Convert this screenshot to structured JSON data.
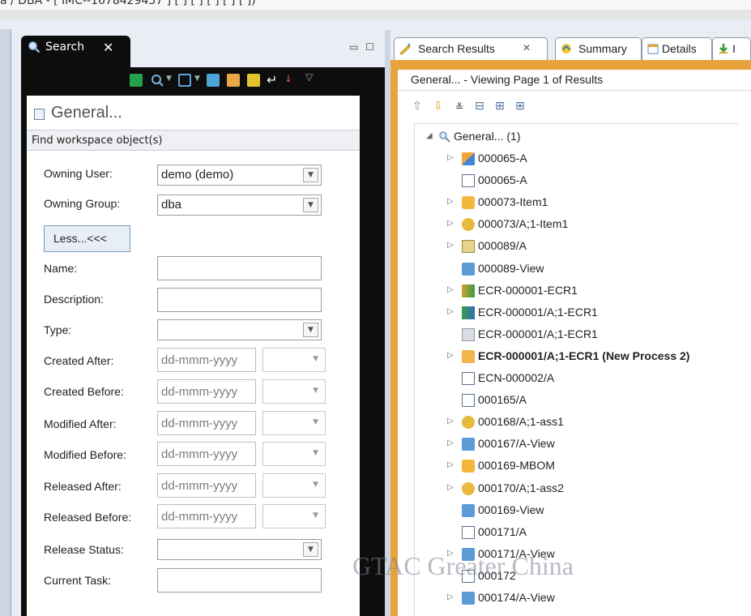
{
  "window": {
    "title_fragment": "a / DBA - [ IMC--1678429437 ] [ ] [ ] [ ] [ ] [ ])"
  },
  "search_view": {
    "tab_label": "Search",
    "form_title": "General...",
    "section_header": "Find workspace object(s)",
    "fields": {
      "owning_user": {
        "label": "Owning User:",
        "value": "demo (demo)"
      },
      "owning_group": {
        "label": "Owning Group:",
        "value": "dba"
      },
      "less_button": "Less...<<<",
      "name": {
        "label": "Name:",
        "value": ""
      },
      "description": {
        "label": "Description:",
        "value": ""
      },
      "type": {
        "label": "Type:",
        "value": ""
      },
      "created_after": {
        "label": "Created After:",
        "placeholder": "dd-mmm-yyyy"
      },
      "created_before": {
        "label": "Created Before:",
        "placeholder": "dd-mmm-yyyy"
      },
      "modified_after": {
        "label": "Modified After:",
        "placeholder": "dd-mmm-yyyy"
      },
      "modified_before": {
        "label": "Modified Before:",
        "placeholder": "dd-mmm-yyyy"
      },
      "released_after": {
        "label": "Released After:",
        "placeholder": "dd-mmm-yyyy"
      },
      "released_before": {
        "label": "Released Before:",
        "placeholder": "dd-mmm-yyyy"
      },
      "release_status": {
        "label": "Release Status:",
        "value": ""
      },
      "current_task": {
        "label": "Current Task:",
        "value": ""
      }
    }
  },
  "results_view": {
    "tabs": [
      {
        "label": "Search Results",
        "icon": "search-results-icon",
        "active": true
      },
      {
        "label": "Summary",
        "icon": "summary-icon"
      },
      {
        "label": "Details",
        "icon": "details-icon"
      },
      {
        "label": "I",
        "icon": "impact-icon"
      }
    ],
    "status": "General... - Viewing Page 1 of Results",
    "root": {
      "label": "General... (1)",
      "icon": "search-icon"
    },
    "items": [
      {
        "label": "000065-A",
        "icon": "item-revision-icon",
        "expandable": true,
        "bold": false
      },
      {
        "label": "000065-A",
        "icon": "dataset-icon",
        "expandable": false,
        "bold": false
      },
      {
        "label": "000073-Item1",
        "icon": "item-icon",
        "expandable": true,
        "bold": false
      },
      {
        "label": "000073/A;1-Item1",
        "icon": "assembly-icon",
        "expandable": true,
        "bold": false
      },
      {
        "label": "000089/A",
        "icon": "folder-icon",
        "expandable": true,
        "bold": false
      },
      {
        "label": "000089-View",
        "icon": "bom-view-icon",
        "expandable": false,
        "bold": false
      },
      {
        "label": "ECR-000001-ECR1",
        "icon": "change-icon",
        "expandable": true,
        "bold": false
      },
      {
        "label": "ECR-000001/A;1-ECR1",
        "icon": "change-revision-icon",
        "expandable": true,
        "bold": false
      },
      {
        "label": "ECR-000001/A;1-ECR1",
        "icon": "form-icon",
        "expandable": false,
        "bold": false
      },
      {
        "label": "ECR-000001/A;1-ECR1 (New Process 2)",
        "icon": "process-icon",
        "expandable": true,
        "bold": true
      },
      {
        "label": "ECN-000002/A",
        "icon": "dataset-icon",
        "expandable": false,
        "bold": false
      },
      {
        "label": "000165/A",
        "icon": "dataset-icon",
        "expandable": false,
        "bold": false
      },
      {
        "label": "000168/A;1-ass1",
        "icon": "assembly-icon",
        "expandable": true,
        "bold": false
      },
      {
        "label": "000167/A-View",
        "icon": "bom-view-icon",
        "expandable": true,
        "bold": false
      },
      {
        "label": "000169-MBOM",
        "icon": "item-icon",
        "expandable": true,
        "bold": false
      },
      {
        "label": "000170/A;1-ass2",
        "icon": "assembly-icon",
        "expandable": true,
        "bold": false
      },
      {
        "label": "000169-View",
        "icon": "bom-view-icon",
        "expandable": false,
        "bold": false
      },
      {
        "label": "000171/A",
        "icon": "dataset-icon",
        "expandable": false,
        "bold": false
      },
      {
        "label": "000171/A-View",
        "icon": "bom-view-icon",
        "expandable": true,
        "bold": false
      },
      {
        "label": "000172",
        "icon": "dataset-icon",
        "expandable": false,
        "bold": false
      },
      {
        "label": "000174/A-View",
        "icon": "bom-view-icon",
        "expandable": true,
        "bold": false
      }
    ]
  },
  "watermark": "GTAC Greater China"
}
